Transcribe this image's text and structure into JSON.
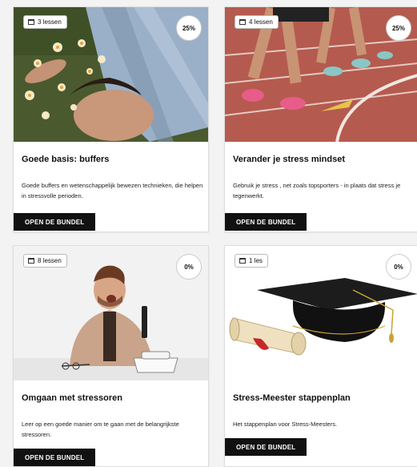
{
  "cards": [
    {
      "lessons": "3 lessen",
      "progress": "25%",
      "title": "Goede basis: buffers",
      "description": "Goede buffers en wetenschappelijk bewezen technieken, die helpen in stressvolle perioden.",
      "button": "OPEN DE BUNDEL"
    },
    {
      "lessons": "4 lessen",
      "progress": "25%",
      "title": "Verander je stress mindset",
      "description": "Gebruik je stress , net zoals topsporters - in plaats dat stress je tegenwerkt.",
      "button": "OPEN DE BUNDEL"
    },
    {
      "lessons": "8 lessen",
      "progress": "0%",
      "title": "Omgaan met stressoren",
      "description": "Leer op een goede manier om te gaan met de belangrijkste stressoren.",
      "button": "OPEN DE BUNDEL"
    },
    {
      "lessons": "1 les",
      "progress": "0%",
      "title": "Stress-Meester stappenplan",
      "description": "Het stappenplan voor Stress-Meesters.",
      "button": "OPEN DE BUNDEL"
    }
  ]
}
